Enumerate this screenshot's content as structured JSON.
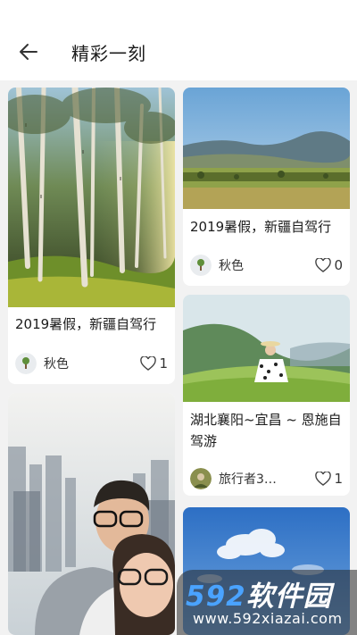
{
  "header": {
    "title": "精彩一刻"
  },
  "cards": [
    {
      "title": "2019暑假，新疆自驾行",
      "author": "秋色",
      "likes": "1"
    },
    {
      "title": "2019暑假，新疆自驾行",
      "author": "秋色",
      "likes": "0"
    },
    {
      "title": "湖北襄阳~宜昌 ~ 恩施自驾游",
      "author": "旅行者3…",
      "likes": "1"
    }
  ],
  "watermark": {
    "brand_digits": "592",
    "brand_text": "软件园",
    "url": "www.592xiazai.com"
  }
}
